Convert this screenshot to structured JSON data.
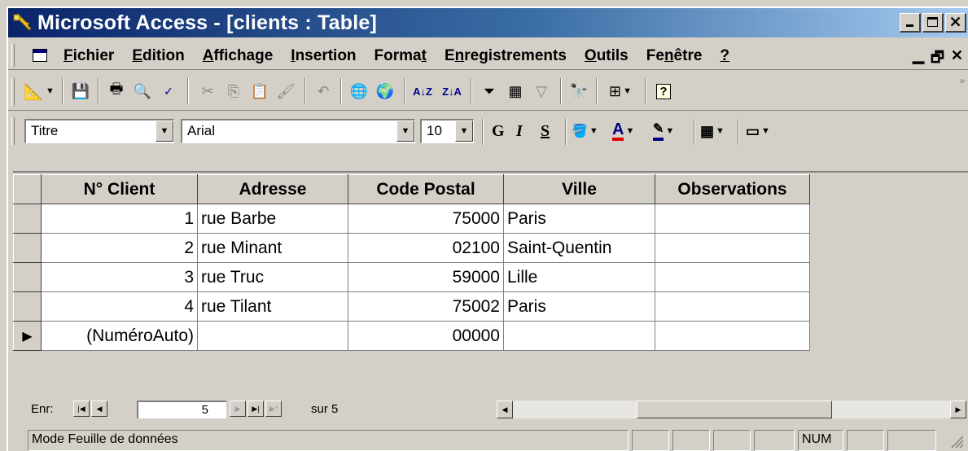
{
  "window": {
    "title": "Microsoft Access - [clients : Table]"
  },
  "menu": {
    "items": [
      {
        "pre": "",
        "ul": "F",
        "post": "ichier"
      },
      {
        "pre": "",
        "ul": "E",
        "post": "dition"
      },
      {
        "pre": "",
        "ul": "A",
        "post": "ffichage"
      },
      {
        "pre": "",
        "ul": "I",
        "post": "nsertion"
      },
      {
        "pre": "Forma",
        "ul": "t",
        "post": ""
      },
      {
        "pre": "E",
        "ul": "n",
        "post": "registrements"
      },
      {
        "pre": "",
        "ul": "O",
        "post": "utils"
      },
      {
        "pre": "Fe",
        "ul": "n",
        "post": "être"
      },
      {
        "pre": "",
        "ul": "?",
        "post": ""
      }
    ]
  },
  "formatbar": {
    "object_combo": "Titre",
    "font_combo": "Arial",
    "size_combo": "10",
    "bold_label": "G",
    "italic_label": "I",
    "underline_label": "S"
  },
  "table": {
    "headers": [
      "N° Client",
      "Adresse",
      "Code Postal",
      "Ville",
      "Observations"
    ],
    "rows": [
      {
        "id": "1",
        "adresse": "rue Barbe",
        "cp": "75000",
        "ville": "Paris",
        "obs": ""
      },
      {
        "id": "2",
        "adresse": "rue Minant",
        "cp": "02100",
        "ville": "Saint-Quentin",
        "obs": ""
      },
      {
        "id": "3",
        "adresse": "rue Truc",
        "cp": "59000",
        "ville": "Lille",
        "obs": ""
      },
      {
        "id": "4",
        "adresse": "rue Tilant",
        "cp": "75002",
        "ville": "Paris",
        "obs": ""
      }
    ],
    "new_row": {
      "id": "(NuméroAuto)",
      "adresse": "",
      "cp": "00000",
      "ville": "",
      "obs": ""
    }
  },
  "navigation": {
    "label": "Enr:",
    "current": "5",
    "of_text": "sur 5"
  },
  "statusbar": {
    "mode": "Mode Feuille de données",
    "num": "NUM"
  }
}
